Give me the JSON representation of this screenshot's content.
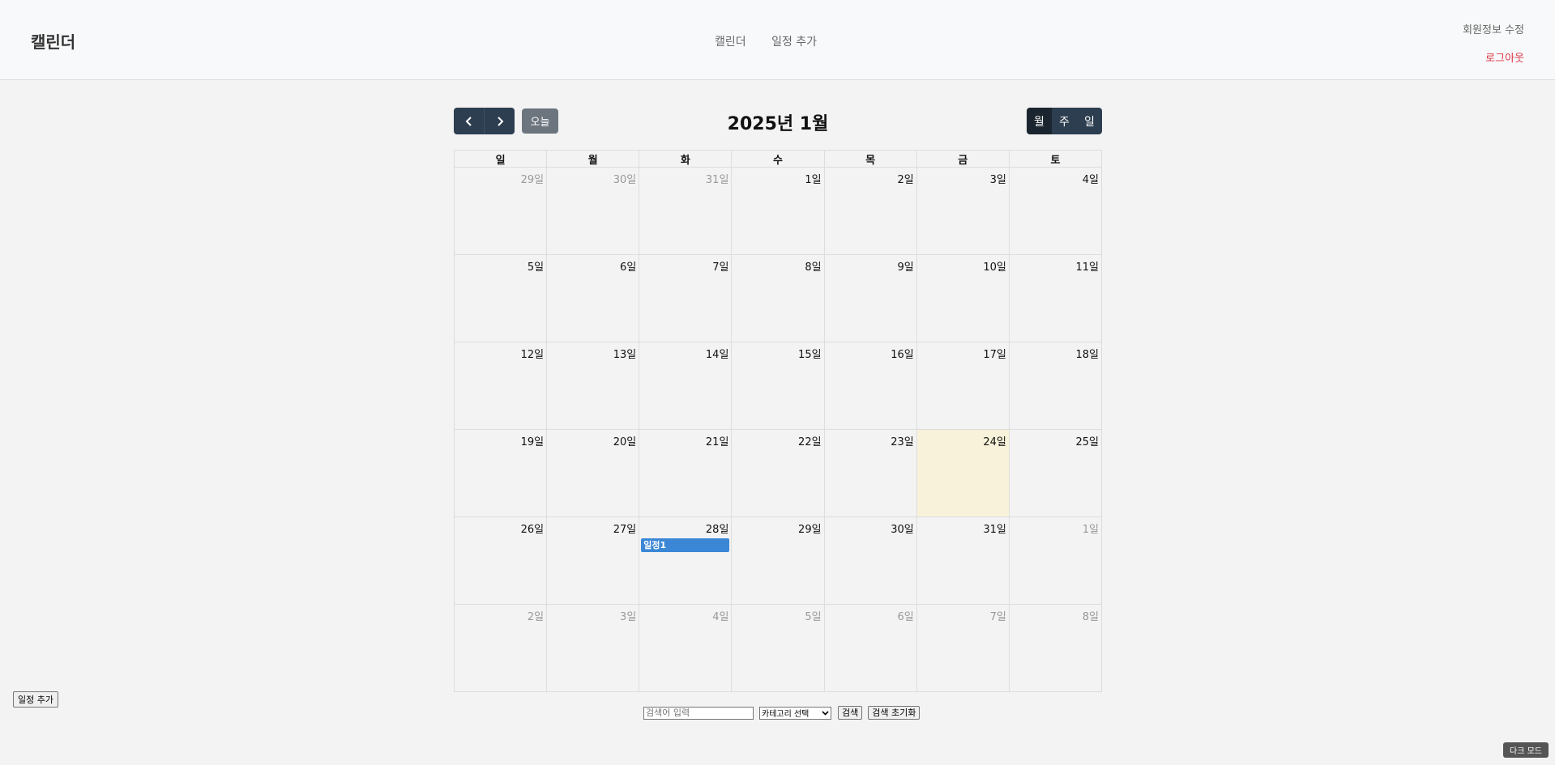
{
  "navbar": {
    "brand": "캘린더",
    "links": [
      "캘린더",
      "일정 추가"
    ],
    "profile": "회원정보 수정",
    "logout": "로그아웃"
  },
  "toolbar": {
    "prev_icon": "chevron-left-icon",
    "next_icon": "chevron-right-icon",
    "today": "오늘",
    "title": "2025년 1월",
    "views": [
      "월",
      "주",
      "일"
    ],
    "active_view": "월"
  },
  "calendar": {
    "weekdays": [
      "일",
      "월",
      "화",
      "수",
      "목",
      "금",
      "토"
    ],
    "weeks": [
      [
        {
          "d": "29일",
          "o": true
        },
        {
          "d": "30일",
          "o": true
        },
        {
          "d": "31일",
          "o": true
        },
        {
          "d": "1일"
        },
        {
          "d": "2일"
        },
        {
          "d": "3일"
        },
        {
          "d": "4일"
        }
      ],
      [
        {
          "d": "5일"
        },
        {
          "d": "6일"
        },
        {
          "d": "7일"
        },
        {
          "d": "8일"
        },
        {
          "d": "9일"
        },
        {
          "d": "10일"
        },
        {
          "d": "11일"
        }
      ],
      [
        {
          "d": "12일"
        },
        {
          "d": "13일"
        },
        {
          "d": "14일"
        },
        {
          "d": "15일"
        },
        {
          "d": "16일"
        },
        {
          "d": "17일"
        },
        {
          "d": "18일"
        }
      ],
      [
        {
          "d": "19일"
        },
        {
          "d": "20일"
        },
        {
          "d": "21일"
        },
        {
          "d": "22일"
        },
        {
          "d": "23일"
        },
        {
          "d": "24일",
          "today": true
        },
        {
          "d": "25일"
        }
      ],
      [
        {
          "d": "26일"
        },
        {
          "d": "27일"
        },
        {
          "d": "28일",
          "event": "일정1"
        },
        {
          "d": "29일"
        },
        {
          "d": "30일"
        },
        {
          "d": "31일"
        },
        {
          "d": "1일",
          "o": true
        }
      ],
      [
        {
          "d": "2일",
          "o": true
        },
        {
          "d": "3일",
          "o": true
        },
        {
          "d": "4일",
          "o": true
        },
        {
          "d": "5일",
          "o": true
        },
        {
          "d": "6일",
          "o": true
        },
        {
          "d": "7일",
          "o": true
        },
        {
          "d": "8일",
          "o": true
        }
      ]
    ]
  },
  "side_add": "일정 추가",
  "search": {
    "placeholder": "검색어 입력",
    "category_selected": "카테고리 선택",
    "search_button": "검색",
    "reset_button": "검색 초기화"
  },
  "dark_mode": "다크 모드",
  "colors": {
    "primary_dark": "#2c3e50",
    "event": "#3b87d6",
    "today_bg": "#f7f2d9",
    "logout": "#dc3545"
  }
}
